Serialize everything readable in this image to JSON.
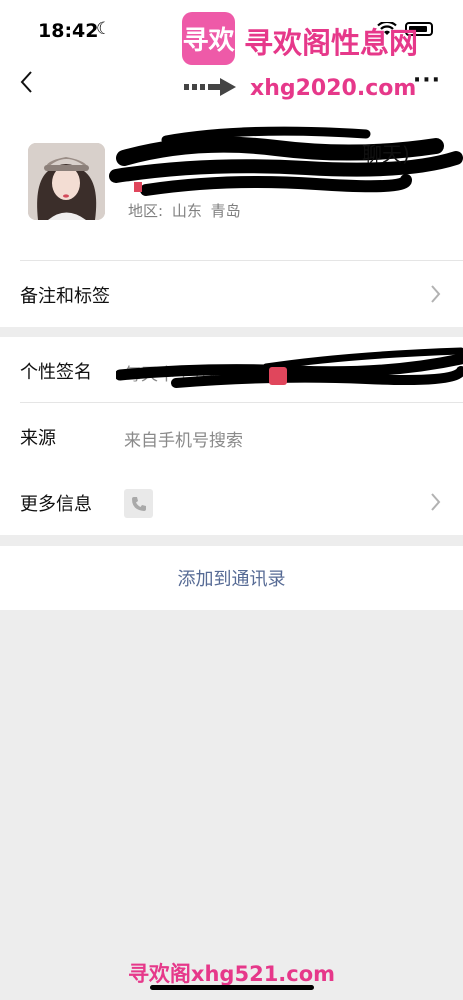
{
  "status_bar": {
    "time": "18:42",
    "moon_icon": "☾"
  },
  "nav": {
    "more_label": "···"
  },
  "watermark": {
    "logo_text": "寻欢",
    "title": "寻欢阁性息网",
    "url": "xhg2020.com",
    "bottom_text": "寻欢阁xhg521.com"
  },
  "profile": {
    "name_tail": "聊天)",
    "region_label": "地区:",
    "region_province": "山东",
    "region_city": "青岛"
  },
  "rows": {
    "remark": {
      "label": "备注和标签"
    },
    "signature": {
      "label": "个性签名",
      "value": "每天中午开闷"
    },
    "source": {
      "label": "来源",
      "value": "来自手机号搜索"
    },
    "more_info": {
      "label": "更多信息",
      "icon": "phone-icon"
    }
  },
  "actions": {
    "add_contact": "添加到通讯录"
  },
  "colors": {
    "link": "#576b95",
    "background": "#ededed",
    "watermark": "#e6388a"
  }
}
